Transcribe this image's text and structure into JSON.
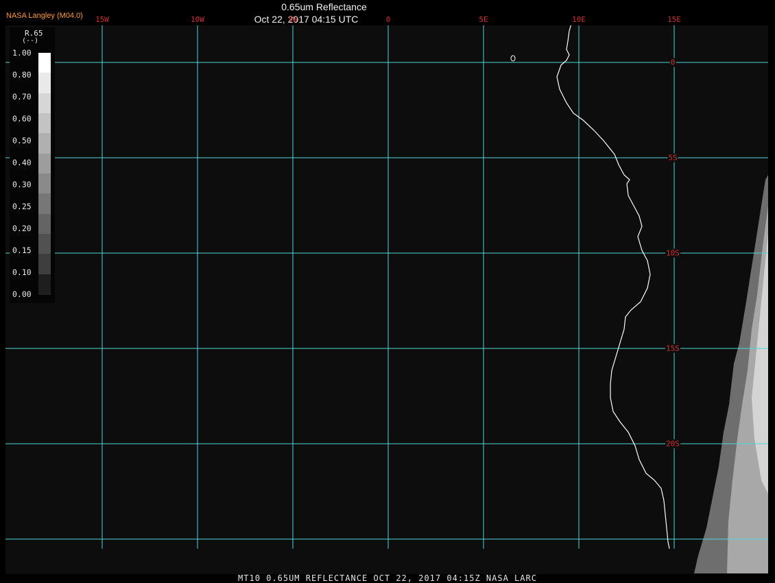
{
  "header": {
    "producer": "NASA Langley (M04.0)",
    "title": "0.65um Reflectance",
    "timestamp": "Oct 22, 2017 04:15 UTC"
  },
  "footer": {
    "caption": "MT10  0.65UM REFLECTANCE   OCT 22, 2017 04:15Z   NASA LARC"
  },
  "map": {
    "background_color": "#0d0d0d",
    "grid_color": "#4fd6dc",
    "coastline_color": "#ffffff",
    "label_color": "#d03030",
    "lon_labels": [
      {
        "text": "15W",
        "lon": -15
      },
      {
        "text": "10W",
        "lon": -10
      },
      {
        "text": "5W",
        "lon": -5
      },
      {
        "text": "0",
        "lon": 0
      },
      {
        "text": "5E",
        "lon": 5
      },
      {
        "text": "10E",
        "lon": 10
      },
      {
        "text": "15E",
        "lon": 15
      }
    ],
    "lat_labels": [
      {
        "text": "0",
        "lat": 0
      },
      {
        "text": "5S",
        "lat": -5
      },
      {
        "text": "10S",
        "lat": -10
      },
      {
        "text": "15S",
        "lat": -15
      },
      {
        "text": "20S",
        "lat": -20
      }
    ]
  },
  "colorbar": {
    "variable": "R.65",
    "unit": "(--)",
    "ticks": [
      "1.00",
      "0.80",
      "0.70",
      "0.60",
      "0.50",
      "0.40",
      "0.30",
      "0.25",
      "0.20",
      "0.15",
      "0.10",
      "0.00"
    ],
    "segment_colors": [
      "#ffffff",
      "#e9e9e9",
      "#d6d6d6",
      "#c3c3c3",
      "#b0b0b0",
      "#9d9d9d",
      "#8a8a8a",
      "#777777",
      "#646464",
      "#515151",
      "#3e3e3e",
      "#1e1e1e"
    ]
  }
}
